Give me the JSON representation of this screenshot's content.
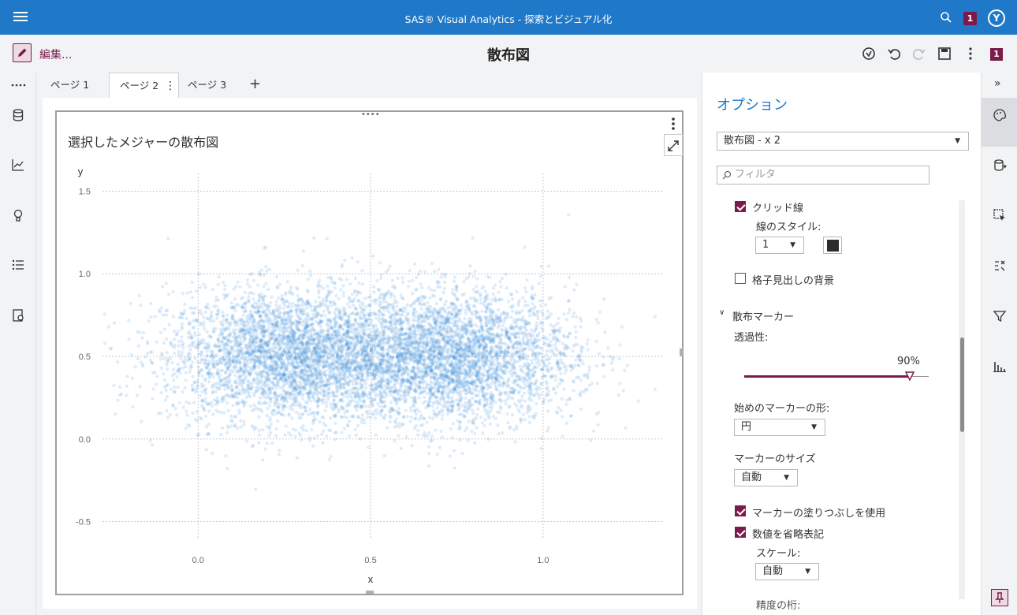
{
  "app": {
    "title": "SAS® Visual Analytics - 探索とビジュアル化",
    "notification_count": "1",
    "avatar_initial": "Y"
  },
  "toolbar": {
    "edit_label": "編集...",
    "report_title": "散布図",
    "notification_count": "1"
  },
  "tabs": [
    {
      "label": "ページ 1"
    },
    {
      "label": "ページ 2"
    },
    {
      "label": "ページ 3"
    }
  ],
  "plot": {
    "title": "選択したメジャーの散布図"
  },
  "chart_data": {
    "type": "scatter",
    "title": "選択したメジャーの散布図",
    "xlabel": "x",
    "ylabel": "y",
    "xlim": [
      -0.3,
      1.35
    ],
    "ylim": [
      -0.55,
      1.55
    ],
    "xticks": [
      "0.0",
      "0.5",
      "1.0"
    ],
    "yticks": [
      "1.5",
      "1.0",
      "0.5",
      "0.0",
      "-0.5"
    ],
    "grid": true,
    "marker_color": "#2f86d6",
    "marker_transparency_percent": 90,
    "clusters": [
      {
        "center": [
          0.27,
          0.5
        ],
        "sd_x": 0.18,
        "sd_y": 0.2
      },
      {
        "center": [
          0.73,
          0.5
        ],
        "sd_x": 0.18,
        "sd_y": 0.2
      }
    ]
  },
  "options": {
    "title": "オプション",
    "selected_object": "散布図 - x 2",
    "filter_placeholder": "フィルタ",
    "grid_lines_label": "クリッド線",
    "line_style_label": "線のスタイル:",
    "line_style_value": "1",
    "grid_header_bg_label": "格子見出しの背景",
    "scatter_marker_label": "散布マーカー",
    "transparency_label": "透過性:",
    "transparency_value": "90%",
    "marker_shape_label": "始めのマーカーの形:",
    "marker_shape_value": "円",
    "marker_size_label": "マーカーのサイズ",
    "marker_size_value": "自動",
    "marker_fill_label": "マーカーの塗りつぶしを使用",
    "abbrev_label": "数値を省略表記",
    "scale_label": "スケール:",
    "scale_value": "自動",
    "precision_label": "精度の桁:"
  },
  "colors": {
    "brand_blue": "#1f78c8",
    "accent_plum": "#7a1b4b"
  }
}
